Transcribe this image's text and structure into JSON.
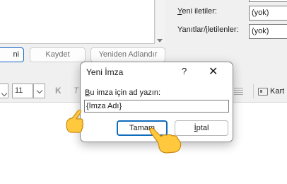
{
  "background": {
    "left_buttons": {
      "new_partial": "ni",
      "save": "Kaydet",
      "rename": "Yeniden Adlandır"
    },
    "right_fields": [
      {
        "label_prefix": "",
        "label_key": "Y",
        "label_rest": "eni iletiler:",
        "value": "(yok)"
      },
      {
        "label_prefix": "Yanıtlar/",
        "label_key": "i",
        "label_rest": "letilenler:",
        "value": "(yok)"
      }
    ],
    "toolbar": {
      "font_size": "11",
      "bold": "K",
      "italic": "T",
      "card_label": "Kart"
    }
  },
  "dialog": {
    "title": "Yeni İmza",
    "help": "?",
    "close": "✕",
    "prompt_key": "B",
    "prompt_rest": "u imza için ad yazın:",
    "input_value": "{İmza Adı}",
    "ok_label": "Tamam",
    "cancel_key": "İ",
    "cancel_rest": "ptal"
  },
  "icons": {
    "pointer_hand_1": "pointing-hand-icon",
    "pointer_hand_2": "pointing-hand-icon"
  },
  "colors": {
    "accent": "#0f6cbd",
    "hand_fill": "#ffc83d"
  }
}
